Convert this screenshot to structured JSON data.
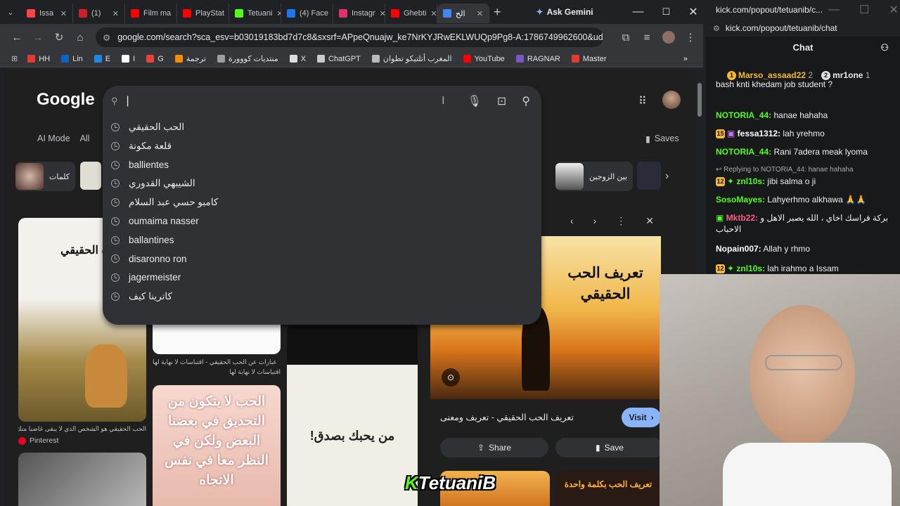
{
  "tabs": [
    {
      "label": "Issa",
      "color": "#ff4444"
    },
    {
      "label": "(1)",
      "color": "#d11c2b"
    },
    {
      "label": "Film ma",
      "color": "#ff0000"
    },
    {
      "label": "PlayStat",
      "color": "#ff0000"
    },
    {
      "label": "Tetuani",
      "color": "#53fc18"
    },
    {
      "label": "(4) Face",
      "color": "#1877f2"
    },
    {
      "label": "Instagr",
      "color": "#e1306c"
    },
    {
      "label": "Ghebti",
      "color": "#ff0000"
    },
    {
      "label": "الح",
      "color": "#4285f4"
    }
  ],
  "gemini_label": "Ask Gemini",
  "url": "google.com/search?sca_esv=b03019183bd7d7c8&sxsrf=APpeQnuajw_ke7NrKYJRwEKLWUQp9Pg8-A:1786749962600&udm...",
  "bookmarks": [
    {
      "label": "HH",
      "color": "#e53935"
    },
    {
      "label": "Lin",
      "color": "#0a66c2"
    },
    {
      "label": "E",
      "color": "#1e88e5"
    },
    {
      "label": "I",
      "color": "#fff"
    },
    {
      "label": "G",
      "color": "#ea4335"
    },
    {
      "label": "ترجمة",
      "color": "#fb8c00"
    },
    {
      "label": "منتديات كووورة",
      "color": "#9e9e9e"
    },
    {
      "label": "X",
      "color": "#ddd"
    },
    {
      "label": "ChatGPT",
      "color": "#ccc"
    },
    {
      "label": "المغرب أتلتيكو تطوان",
      "color": "#bbb"
    },
    {
      "label": "YouTube",
      "color": "#ff0000"
    },
    {
      "label": "RAGNAR",
      "color": "#7e57c2"
    },
    {
      "label": "Master",
      "color": "#e53935"
    }
  ],
  "google": {
    "logo": "Google",
    "search_value": "|",
    "suggestions": [
      "الحب الحقيقي",
      "قلعة مكونة",
      "ballientes",
      "الشيبهي القدوري",
      "كامبو حسي عبد السلام",
      "oumaima nasser",
      "ballantines",
      "disaronno ron",
      "jagermeister",
      "كاترينا كيف"
    ],
    "tabs": [
      "AI Mode",
      "All"
    ],
    "saves": "Saves",
    "chips": [
      {
        "label": "كلمات"
      },
      {
        "label": "بين الزوجين"
      }
    ],
    "preview": {
      "caption": "تعريف الحب الحقيقي - تعريف ومعنى",
      "visit": "Visit",
      "share": "Share",
      "save": "Save",
      "image_text": "تعريف الحب الحقيقي"
    },
    "results": [
      {
        "caption": "الحب الحقيقي هو الشخص الذي لا يبقى غاضبا منك ولا",
        "source": "Pinterest"
      },
      {
        "caption": "عبارات عن الحب الحقيقي - اقتباسات لا نهاية لها",
        "source": "اقتباسات لا نهاية لها"
      }
    ],
    "card1_text": "ب الحقيقي",
    "card4_text": "الحب لا يتكون من التحديق في بعضنا البعض ولكن في النظر معا في نفس الاتجاه",
    "card5_text": "من يحبك بصدق!",
    "card6_text": "تعريف الحب بكلمة واحدة"
  },
  "kick": {
    "url": "kick.com/popout/tetuanib/c...",
    "url2": "kick.com/popout/tetuanib/chat",
    "chat_title": "Chat",
    "top": [
      {
        "name": "Marso_assaad22",
        "rank": "2"
      },
      {
        "name": "mr1one",
        "rank": "1"
      }
    ],
    "messages": [
      {
        "user": "",
        "text": "bash knti khedam job student ?",
        "color": "#fff"
      },
      {
        "user": "NOTORIA_44:",
        "text": "hanae hahaha",
        "color": "#53fc18"
      },
      {
        "user": "fessa1312:",
        "text": "lah yrehmo",
        "color": "#fff"
      },
      {
        "user": "NOTORIA_44:",
        "text": "Rani 7adera meak lyoma",
        "color": "#53fc18"
      },
      {
        "user": "znl10s:",
        "text": "jibi salma o ji",
        "color": "#53fc18"
      },
      {
        "user": "SosoMayes:",
        "text": "Lahyerhmo alkhawa 🙏🙏",
        "color": "#53fc18"
      },
      {
        "user": "Mktb22:",
        "text": "بركة فراسك اخاي ، الله يصبر الاهل و الاحباب",
        "color": "#ff5c8a"
      },
      {
        "user": "Nopain007:",
        "text": "Allah y rhmo",
        "color": "#fff"
      },
      {
        "user": "znl10s:",
        "text": "lah irahmo a Issam",
        "color": "#53fc18"
      }
    ],
    "reply_note": "Replying to NOTORIA_44: hanae hahaha",
    "badge_15": "15",
    "badge_12": "12",
    "overlay_brand": "TetuaniB"
  }
}
